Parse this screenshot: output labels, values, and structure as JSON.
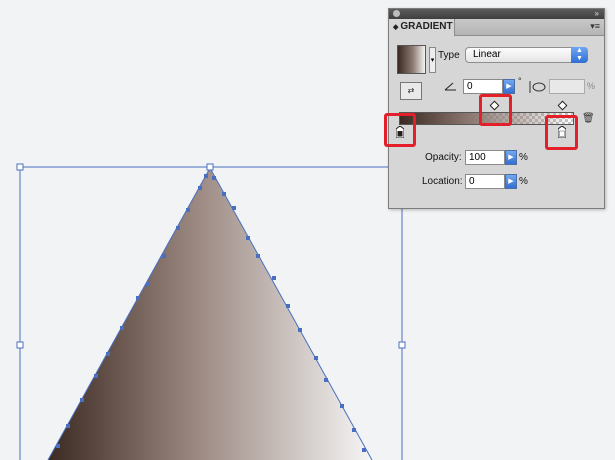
{
  "panel": {
    "title": "GRADIENT",
    "type_label": "Type",
    "type_value": "Linear",
    "angle_value": "0",
    "angle_unit": "°",
    "aspect_value": "",
    "aspect_unit": "%",
    "opacity_label": "Opacity:",
    "opacity_value": "100",
    "opacity_unit": "%",
    "location_label": "Location:",
    "location_value": "0",
    "location_unit": "%"
  },
  "icons": {
    "close": "close-dot",
    "collapse": "double-chevron-icon",
    "menu": "panel-menu-icon",
    "type_select": "up-down-arrows",
    "reverse": "reverse-gradient-icon",
    "angle": "angle-icon",
    "aspect": "aspect-ratio-icon",
    "delete": "trash-icon"
  },
  "colors": {
    "gradient_start": "#3b2a22",
    "gradient_end": "#f4f4f4",
    "selection": "#4a6fc1",
    "highlight": "#e3202a",
    "button_blue": "#356fd0"
  }
}
